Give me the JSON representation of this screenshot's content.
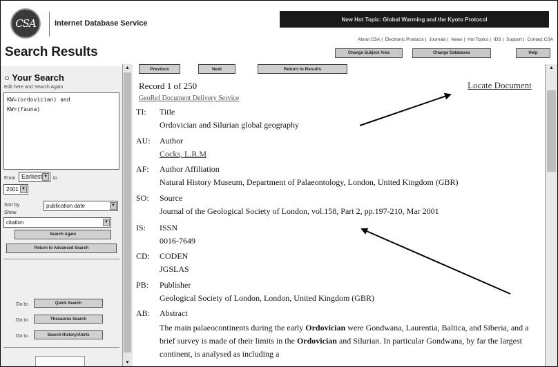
{
  "header": {
    "logo_text": "CSA",
    "service_name": "Internet Database Service",
    "hot_topic": "New Hot Topic: Global Warming and the Kyoto Protocol",
    "top_links": [
      "About CSA",
      "Electronic Products",
      "Journals",
      "News",
      "Hot Topics",
      "IDS",
      "Support",
      "Contact CSA"
    ],
    "page_title": "Search Results",
    "buttons": {
      "change_subject": "Change Subject Area",
      "change_databases": "Change Databases",
      "help": "Help"
    }
  },
  "sidebar": {
    "heading": "Your Search",
    "edit_hint": "Edit here and Search Again",
    "query": "KW=(ordovician) and\nKW=(fauna)",
    "from_label": "From",
    "from_value": "Earliest",
    "to_label": "to",
    "to_value": "2001",
    "sort_label": "Sort by",
    "sort_value": "publication date",
    "show_label": "Show",
    "show_value": "citation",
    "search_again": "Search Again",
    "return_advanced": "Return to Advanced Search",
    "goto": [
      {
        "label": "Go to",
        "button": "Quick Search"
      },
      {
        "label": "Go to",
        "button": "Thesaurus Search"
      },
      {
        "label": "Go to",
        "button": "Search History/Alerts"
      }
    ]
  },
  "nav": {
    "previous": "Previous",
    "next": "Next",
    "return_results": "Return to Results"
  },
  "record": {
    "count": "Record 1 of 250",
    "delivery_link": "GeoRef Document Delivery Service",
    "locate_link": "Locate Document",
    "fields": {
      "ti": {
        "code": "TI:",
        "label": "Title",
        "value": "Ordovician and Silurian global geography"
      },
      "au": {
        "code": "AU:",
        "label": "Author",
        "value": "Cocks, L.R.M"
      },
      "af": {
        "code": "AF:",
        "label": "Author Affiliation",
        "value": "Natural History Museum, Department of Palaeontology, London, United Kingdom (GBR)"
      },
      "so": {
        "code": "SO:",
        "label": "Source",
        "value": "Journal of the Geological Society of London, vol.158, Part 2, pp.197-210, Mar 2001"
      },
      "is": {
        "code": "IS:",
        "label": "ISSN",
        "value": "0016-7649"
      },
      "cd": {
        "code": "CD:",
        "label": "CODEN",
        "value": "JGSLAS"
      },
      "pb": {
        "code": "PB:",
        "label": "Publisher",
        "value": "Geological Society of London, London, United Kingdom (GBR)"
      },
      "ab": {
        "code": "AB:",
        "label": "Abstract",
        "text_1": "The main palaeocontinents during the early ",
        "highlight_1": "Ordovician",
        "text_2": " were Gondwana, Laurentia, Baltica, and Siberia, and a brief survey is made of their limits in the ",
        "highlight_2": "Ordovician",
        "text_3": " and Silurian. In particular Gondwana, by far the largest continent, is analysed as including a"
      }
    }
  }
}
